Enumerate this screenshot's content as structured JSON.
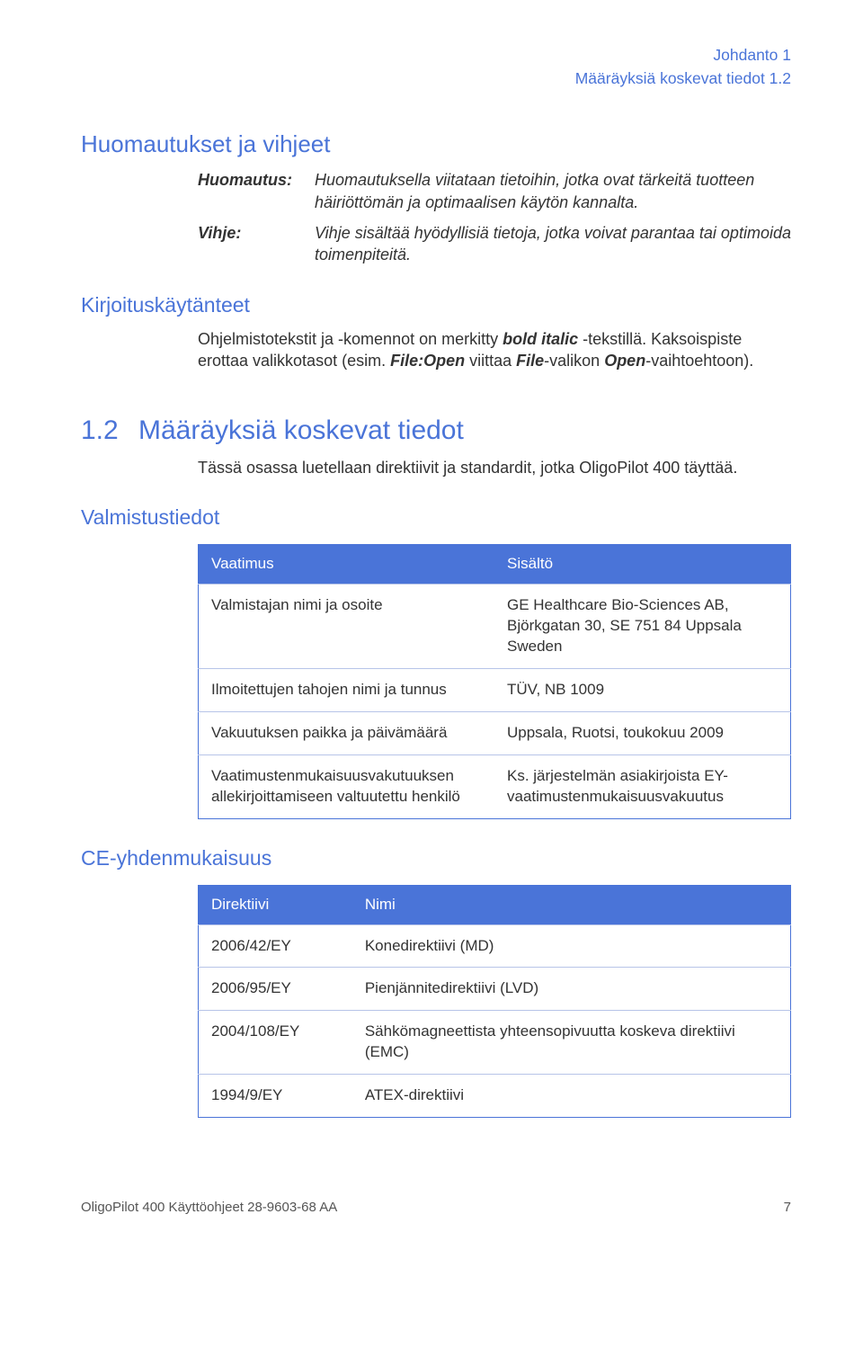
{
  "header": {
    "line1": "Johdanto 1",
    "line2": "Määräyksiä koskevat tiedot 1.2"
  },
  "sec_notes": {
    "title": "Huomautukset ja vihjeet",
    "rows": [
      {
        "label": "Huomautus:",
        "text": "Huomautuksella viitataan tietoihin, jotka ovat tärkeitä tuotteen häiriöttömän ja optimaalisen käytön kannalta."
      },
      {
        "label": "Vihje:",
        "text": "Vihje sisältää hyödyllisiä tietoja, jotka voivat parantaa tai optimoida toimenpiteitä."
      }
    ]
  },
  "sec_typo": {
    "title": "Kirjoituskäytänteet",
    "p1a": "Ohjelmistotekstit ja -komennot on merkitty ",
    "p1b": "bold italic",
    "p1c": " -tekstillä. Kaksoispiste erottaa valikkotasot (esim. ",
    "p1d": "File:Open",
    "p1e": " viittaa ",
    "p1f": "File",
    "p1g": "-valikon ",
    "p1h": "Open",
    "p1i": "-vaihtoehtoon)."
  },
  "sec12": {
    "num": "1.2",
    "title": "Määräyksiä koskevat tiedot",
    "intro": "Tässä osassa luetellaan direktiivit ja standardit, jotka OligoPilot 400 täyttää."
  },
  "valmistus": {
    "title": "Valmistustiedot",
    "headers": [
      "Vaatimus",
      "Sisältö"
    ],
    "rows": [
      [
        "Valmistajan nimi ja osoite",
        "GE Healthcare Bio-Sciences AB, Björkgatan 30, SE 751 84 Uppsala Sweden"
      ],
      [
        "Ilmoitettujen tahojen nimi ja tunnus",
        "TÜV, NB 1009"
      ],
      [
        "Vakuutuksen paikka ja päivämäärä",
        "Uppsala, Ruotsi, toukokuu 2009"
      ],
      [
        "Vaatimustenmukaisuusvakutuuksen allekirjoittamiseen valtuutettu henkilö",
        "Ks. järjestelmän asiakirjoista EY-vaatimustenmukaisuusvakuutus"
      ]
    ]
  },
  "ce": {
    "title": "CE‑yhdenmukaisuus",
    "headers": [
      "Direktiivi",
      "Nimi"
    ],
    "rows": [
      [
        "2006/42/EY",
        "Konedirektiivi (MD)"
      ],
      [
        "2006/95/EY",
        "Pienjännitedirektiivi (LVD)"
      ],
      [
        "2004/108/EY",
        "Sähkömagneettista yhteensopivuutta koskeva direktiivi (EMC)"
      ],
      [
        "1994/9/EY",
        "ATEX-direktiivi"
      ]
    ]
  },
  "footer": {
    "left": "OligoPilot 400 Käyttöohjeet 28-9603-68 AA",
    "right": "7"
  }
}
